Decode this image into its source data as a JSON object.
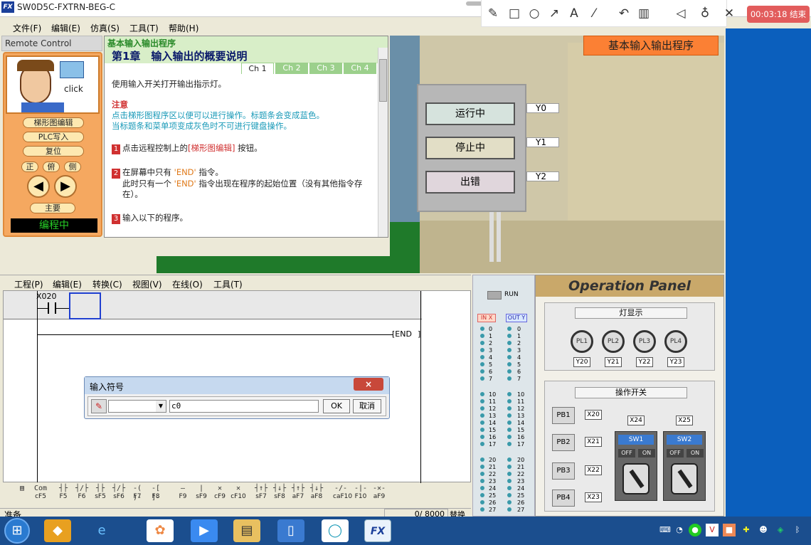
{
  "app": {
    "title": "SW0D5C-FXTRN-BEG-C",
    "logo": "FX"
  },
  "recorder": {
    "timer": "00:03:18 结束",
    "tools": [
      "pen-icon",
      "rectangle-icon",
      "circle-icon",
      "arrow-icon",
      "text-icon",
      "magic-wand-icon",
      "undo-icon",
      "trash-icon",
      "speaker-icon",
      "microphone-icon",
      "close-icon"
    ]
  },
  "menu": [
    "文件(F)",
    "编辑(E)",
    "仿真(S)",
    "工具(T)",
    "帮助(H)"
  ],
  "remote": {
    "label": "Remote Control",
    "click": "click",
    "buttons": {
      "ladder_edit": "梯形图编辑",
      "plc_write": "PLC写入",
      "reset": "复位"
    },
    "views": [
      "正",
      "俯",
      "侧"
    ],
    "main": "主要",
    "status": "编程中"
  },
  "doc": {
    "header": "基本输入输出程序",
    "chapter": "第1章　输入输出的概要说明",
    "tabs": [
      "Ch 1",
      "Ch 2",
      "Ch 3",
      "Ch 4"
    ],
    "intro": "使用输入开关打开输出指示灯。",
    "note_title": "注意",
    "note_1": "点击梯形图程序区以便可以进行操作。标题条会变成蓝色。",
    "note_2": "当标题条和菜单项变成灰色时不可进行键盘操作。",
    "step1_num": "1",
    "step1_pre": "点击远程控制上的",
    "step1_key": "[梯形图编辑]",
    "step1_post": " 按钮。",
    "step2_num": "2",
    "step2_pre": "在屏幕中只有 ",
    "step2_end1": "'END'",
    "step2_mid": " 指令。",
    "step2_line2_pre": "此时只有一个 ",
    "step2_end2": "'END'",
    "step2_line2_post": " 指令出现在程序的起始位置（没有其他指令存在）。",
    "step3_num": "3",
    "step3": "输入以下的程序。"
  },
  "scene": {
    "title": "基本输入输出程序",
    "lamps": [
      {
        "label": "运行中",
        "tag": "Y0"
      },
      {
        "label": "停止中",
        "tag": "Y1"
      },
      {
        "label": "出错",
        "tag": "Y2"
      }
    ]
  },
  "ladder": {
    "menu": [
      "工程(P)",
      "编辑(E)",
      "转换(C)",
      "视图(V)",
      "在线(O)",
      "工具(T)"
    ],
    "contact": "X020",
    "end": "END"
  },
  "dialog": {
    "title": "输入符号",
    "close": "×",
    "input_value": "c0",
    "ok": "OK",
    "cancel": "取消"
  },
  "fkeys": [
    {
      "sym": "▤",
      "key": ""
    },
    {
      "sym": "Com",
      "key": "cF5"
    },
    {
      "sym": "┤├",
      "key": "F5"
    },
    {
      "sym": "┤/├",
      "key": "F6"
    },
    {
      "sym": "┤├",
      "key": "sF5"
    },
    {
      "sym": "┤/├",
      "key": "sF6"
    },
    {
      "sym": "-( )-",
      "key": "F7"
    },
    {
      "sym": "-[ ]-",
      "key": "F8"
    },
    {
      "sym": "—",
      "key": "F9"
    },
    {
      "sym": "|",
      "key": "sF9"
    },
    {
      "sym": "✕",
      "key": "cF9"
    },
    {
      "sym": "✕",
      "key": "cF10"
    },
    {
      "sym": "┤↑├",
      "key": "sF7"
    },
    {
      "sym": "┤↓├",
      "key": "sF8"
    },
    {
      "sym": "┤↑├",
      "key": "aF7"
    },
    {
      "sym": "┤↓├",
      "key": "aF8"
    },
    {
      "sym": "-/-",
      "key": "caF10"
    },
    {
      "sym": "-|-",
      "key": "F10"
    },
    {
      "sym": "-✕-",
      "key": "aF9"
    }
  ],
  "status": {
    "ready": "准备",
    "steps": "0/ 8000",
    "mode": "替换"
  },
  "io": {
    "run": "RUN",
    "in_header": "IN X",
    "out_header": "OUT Y",
    "rows": [
      "0",
      "1",
      "2",
      "3",
      "4",
      "5",
      "6",
      "7",
      "10",
      "11",
      "12",
      "13",
      "14",
      "15",
      "16",
      "17",
      "20",
      "21",
      "22",
      "23",
      "24",
      "25",
      "26",
      "27"
    ]
  },
  "panel": {
    "title": "Operation Panel",
    "lamp_section": "灯显示",
    "lamps": [
      {
        "name": "PL1",
        "tag": "Y20"
      },
      {
        "name": "PL2",
        "tag": "Y21"
      },
      {
        "name": "PL3",
        "tag": "Y22"
      },
      {
        "name": "PL4",
        "tag": "Y23"
      }
    ],
    "switch_section": "操作开关",
    "pushbuttons": [
      {
        "name": "PB1",
        "tag": "X20"
      },
      {
        "name": "PB2",
        "tag": "X21"
      },
      {
        "name": "PB3",
        "tag": "X22"
      },
      {
        "name": "PB4",
        "tag": "X23"
      }
    ],
    "switches": [
      {
        "name": "SW1",
        "tag": "X24",
        "off": "OFF",
        "on": "ON"
      },
      {
        "name": "SW2",
        "tag": "X25",
        "off": "OFF",
        "on": "ON"
      }
    ]
  },
  "taskbar": {
    "start": "⊞",
    "apps": [
      "folder-icon",
      "ie-icon",
      "photos-icon",
      "video-icon",
      "explorer-icon",
      "phone-icon",
      "chat-icon",
      "fx-icon"
    ]
  }
}
